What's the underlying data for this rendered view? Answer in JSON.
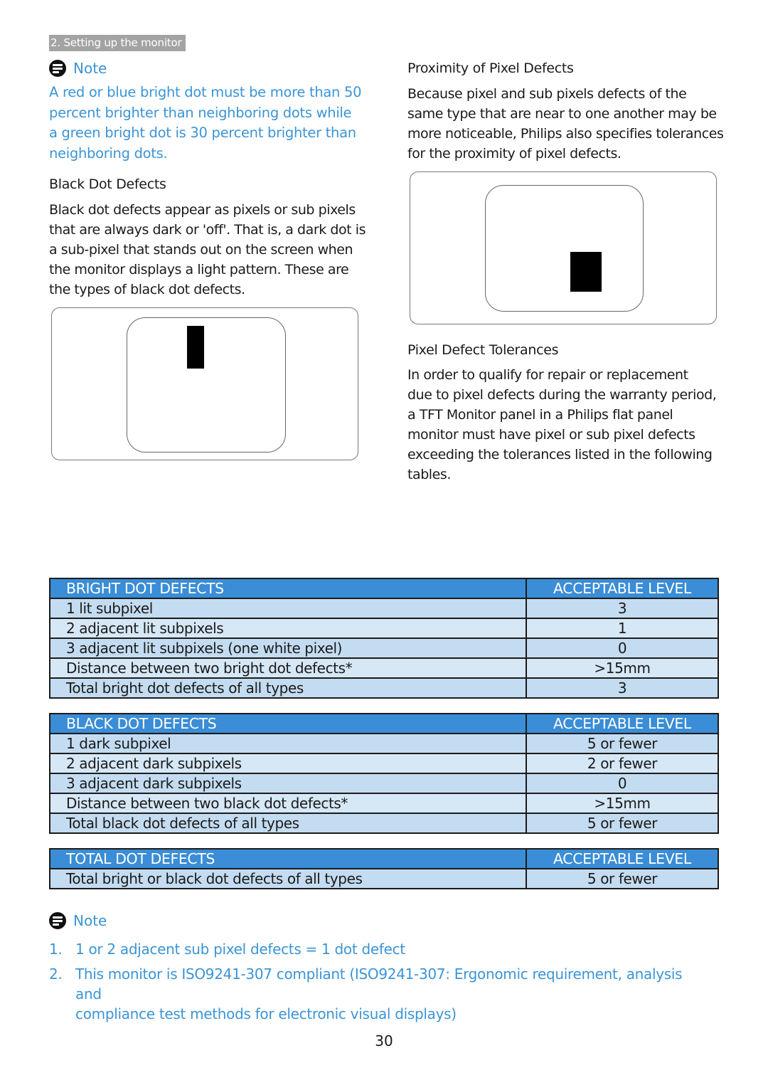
{
  "section_tag": "2. Setting up the monitor",
  "left_column": {
    "note": {
      "title": "Note",
      "lines": [
        "A red or blue bright dot must be more than 50",
        "percent brighter than neighboring dots while",
        "a green bright dot is 30 percent brighter than",
        "neighboring dots."
      ]
    },
    "black_dot": {
      "heading": "Black Dot Defects",
      "lines": [
        "Black dot defects appear as pixels or sub pixels",
        "that are always dark or 'off'. That is, a dark dot is",
        "a sub-pixel that stands out on the screen when",
        "the monitor displays a light pattern. These are",
        "the types of black dot defects."
      ]
    }
  },
  "right_column": {
    "proximity": {
      "heading": "Proximity of Pixel Defects",
      "lines": [
        "Because pixel and sub pixels defects of the",
        "same type that are near to one another may be",
        "more noticeable, Philips also specifies tolerances",
        "for the proximity of pixel defects."
      ]
    },
    "tolerances": {
      "heading": "Pixel Defect Tolerances",
      "lines": [
        "In order to qualify for repair or replacement",
        "due to pixel defects during the warranty period,",
        "a TFT Monitor panel in a Philips flat panel",
        "monitor must have pixel or sub pixel defects",
        "exceeding the tolerances listed in the following",
        "tables."
      ]
    }
  },
  "tables": {
    "bright": {
      "header": [
        "BRIGHT DOT DEFECTS",
        "ACCEPTABLE LEVEL"
      ],
      "rows": [
        [
          "1 lit subpixel",
          "3"
        ],
        [
          "2 adjacent lit subpixels",
          "1"
        ],
        [
          "3 adjacent lit subpixels (one white pixel)",
          "0"
        ],
        [
          "Distance between two bright dot defects*",
          ">15mm"
        ],
        [
          "Total bright dot defects of all types",
          "3"
        ]
      ]
    },
    "black": {
      "header": [
        "BLACK DOT DEFECTS",
        "ACCEPTABLE LEVEL"
      ],
      "rows": [
        [
          "1 dark subpixel",
          "5 or fewer"
        ],
        [
          "2 adjacent dark subpixels",
          "2 or fewer"
        ],
        [
          "3 adjacent dark subpixels",
          "0"
        ],
        [
          "Distance between two black dot defects*",
          ">15mm"
        ],
        [
          "Total black dot defects of all types",
          "5 or fewer"
        ]
      ]
    },
    "total": {
      "header": [
        "TOTAL DOT DEFECTS",
        "ACCEPTABLE LEVEL"
      ],
      "rows": [
        [
          "Total bright or black dot defects of all types",
          "5 or fewer"
        ]
      ]
    }
  },
  "footnote": {
    "title": "Note",
    "items": [
      {
        "num": "1.",
        "lines": [
          "1 or 2 adjacent sub pixel defects = 1 dot defect"
        ]
      },
      {
        "num": "2.",
        "lines": [
          "This monitor is ISO9241-307 compliant (ISO9241-307: Ergonomic requirement, analysis and",
          "compliance test methods for electronic visual displays)"
        ]
      }
    ]
  },
  "page_number": "30",
  "colors": {
    "accent_blue": "#3b94d6",
    "table_header": "#3a8dd6",
    "row_odd": "#c4dcf1",
    "row_even": "#d6e7f6",
    "section_tag_bg": "#a3a3a3"
  }
}
